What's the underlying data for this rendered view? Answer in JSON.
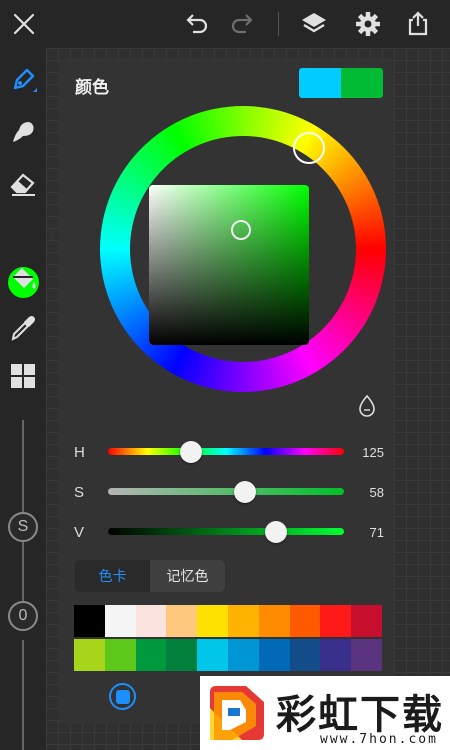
{
  "panel": {
    "title": "颜色",
    "current_color": "#00CCFF",
    "previous_color": "#00BB33",
    "sv_base_color": "#00ff00"
  },
  "active_color": "#00ff00",
  "sliders": [
    {
      "label": "H",
      "value": "125",
      "fraction": 0.35
    },
    {
      "label": "S",
      "value": "58",
      "fraction": 0.58
    },
    {
      "label": "V",
      "value": "71",
      "fraction": 0.71
    }
  ],
  "tabs": [
    {
      "label": "色卡",
      "active": true
    },
    {
      "label": "记忆色",
      "active": false
    }
  ],
  "palette": [
    "#000000",
    "#f5f5f5",
    "#fbe3e0",
    "#fec97e",
    "#ffe100",
    "#ffb300",
    "#ff8c00",
    "#ff5a00",
    "#ff1a1a",
    "#c8102e",
    "#a6d51a",
    "#5cc81a",
    "#009a3e",
    "#00803a",
    "#00c6ea",
    "#0096d6",
    "#006ab8",
    "#124d8a",
    "#3b2f8c",
    "#5b3480"
  ],
  "icons": {
    "top": [
      "close-icon",
      "undo-icon",
      "redo-icon",
      "layers-icon",
      "settings-icon",
      "share-icon"
    ],
    "left": [
      "brush-icon",
      "smudge-icon",
      "eraser-icon",
      "fill-icon",
      "eyedropper-icon",
      "grid-icon"
    ]
  },
  "left_knobs": {
    "size_label": "S",
    "opacity_label": "0"
  },
  "watermark": {
    "title": "彩虹下载",
    "url": "www.7hon.com"
  }
}
